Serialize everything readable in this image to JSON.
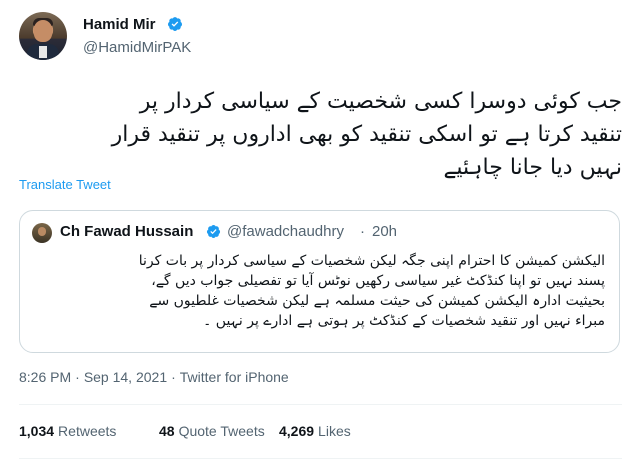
{
  "author": {
    "display_name": "Hamid Mir",
    "handle": "@HamidMirPAK",
    "verified_icon": "verified-badge-icon"
  },
  "tweet": {
    "text": "جب کوئی دوسرا کسی شخصیت کے سیاسی کردار پر\nتنقید کرتا ہے تو اسکی تنقید کو بھی اداروں پر تنقید قرار\nنہیں دیا جانا چاہئیے",
    "translate_label": "Translate Tweet"
  },
  "quoted_tweet": {
    "display_name": "Ch Fawad Hussain",
    "handle": "@fawadchaudhry",
    "dot": "·",
    "time": "20h",
    "text": "الیکشن کمیشن کا احترام اپنی جگہ لیکن شخصیات کے سیاسی کردار پر بات کرنا\nپسند نہیں تو اپنا کنڈکٹ غیر سیاسی رکھیں نوٹس آیا تو تفصیلی جواب دیں گے،\nبحیثیت ادارہ الیکشن کمیشن کی حیثت مسلمہ ہے لیکن شخصیات غلطیوں سے\nمبراء نہیں اور تنقید شخصیات کے کنڈکٹ پر ہوتی ہے ادارے پر نہیں ۔"
  },
  "meta": {
    "time": "8:26 PM",
    "sep1": "·",
    "date": "Sep 14, 2021",
    "sep2": "·",
    "source": "Twitter for iPhone"
  },
  "stats": {
    "retweets_count": "1,034",
    "retweets_label": "Retweets",
    "quotes_count": "48",
    "quotes_label": "Quote Tweets",
    "likes_count": "4,269",
    "likes_label": "Likes"
  },
  "colors": {
    "accent": "#1d9bf0",
    "muted": "#536471",
    "text": "#0f1419",
    "border": "#cfd9de"
  }
}
